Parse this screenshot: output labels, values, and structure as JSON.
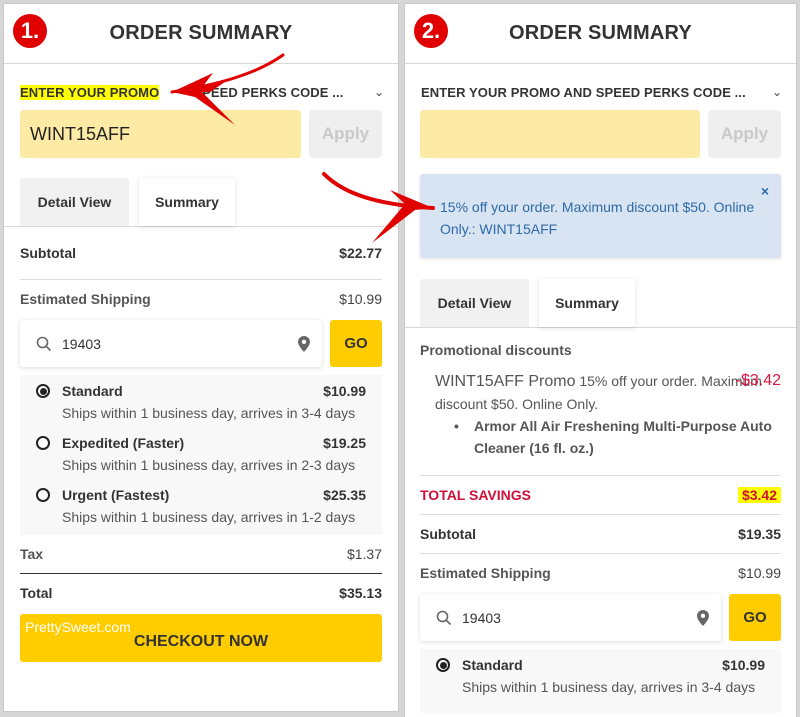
{
  "colors": {
    "accent_yellow": "#ffcc00",
    "promo_input_bg": "#fdeaa5",
    "badge_red": "#e00000",
    "notice_bg": "#d8e4f1",
    "notice_text": "#2c6aa8",
    "discount_red": "#e0143c",
    "highlight": "#ffff00"
  },
  "left": {
    "badge": "1.",
    "title": "ORDER SUMMARY",
    "promo_label_highlighted": "ENTER YOUR PROMO",
    "promo_label_rest": "SPEED PERKS CODE ...",
    "promo_chevron_icon": "chevron-down-icon",
    "promo_input_value": "WINT15AFF",
    "apply_label": "Apply",
    "tabs": [
      {
        "label": "Detail View"
      },
      {
        "label": "Summary"
      }
    ],
    "subtotal_label": "Subtotal",
    "subtotal_value": "$22.77",
    "shipping_label": "Estimated Shipping",
    "shipping_value": "$10.99",
    "zip_value": "19403",
    "go_label": "GO",
    "shipping_options": [
      {
        "name": "Standard",
        "price": "$10.99",
        "desc": "Ships within 1 business day, arrives in 3-4 days",
        "selected": true
      },
      {
        "name": "Expedited (Faster)",
        "price": "$19.25",
        "desc": "Ships within 1 business day, arrives in 2-3 days",
        "selected": false
      },
      {
        "name": "Urgent (Fastest)",
        "price": "$25.35",
        "desc": "Ships within 1 business day, arrives in 1-2 days",
        "selected": false
      }
    ],
    "tax_label": "Tax",
    "tax_value": "$1.37",
    "total_label": "Total",
    "total_value": "$35.13",
    "checkout_label": "CHECKOUT NOW",
    "watermark": "PrettySweet.com"
  },
  "right": {
    "badge": "2.",
    "title": "ORDER SUMMARY",
    "promo_label": "ENTER YOUR PROMO AND SPEED PERKS CODE ...",
    "promo_input_value": "",
    "apply_label": "Apply",
    "notice_text": "15% off your order. Maximum discount $50. Online Only.: WINT15AFF",
    "notice_close": "×",
    "tabs": [
      {
        "label": "Detail View"
      },
      {
        "label": "Summary"
      }
    ],
    "promo_section_title": "Promotional discounts",
    "promo_code": "WINT15AFF Promo",
    "promo_desc": "15% off your order. Maximum discount $50. Online Only.",
    "promo_amount": "-$3.42",
    "promo_product": "Armor All Air Freshening Multi-Purpose Auto Cleaner (16 fl. oz.)",
    "savings_label": "TOTAL SAVINGS",
    "savings_value": "$3.42",
    "subtotal_label": "Subtotal",
    "subtotal_value": "$19.35",
    "shipping_label": "Estimated Shipping",
    "shipping_value": "$10.99",
    "zip_value": "19403",
    "go_label": "GO",
    "shipping_options": [
      {
        "name": "Standard",
        "price": "$10.99",
        "desc": "Ships within 1 business day, arrives in 3-4 days",
        "selected": true
      }
    ]
  }
}
